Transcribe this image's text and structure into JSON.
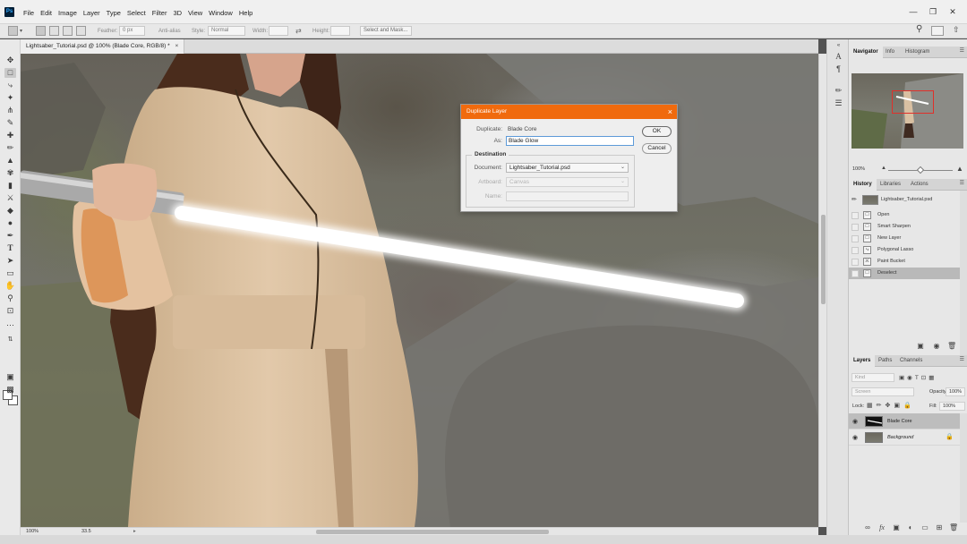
{
  "app": {
    "logo": "Ps",
    "menu": [
      "File",
      "Edit",
      "Image",
      "Layer",
      "Type",
      "Select",
      "Filter",
      "3D",
      "View",
      "Window",
      "Help"
    ],
    "window_controls": [
      "minimize",
      "restore",
      "close"
    ]
  },
  "options_bar": {
    "feather_label": "Feather:",
    "feather_value": "0 px",
    "antialias_label": "Anti-alias",
    "style_label": "Style:",
    "style_value": "Normal",
    "width_label": "Width:",
    "height_label": "Height:",
    "select_mask_label": "Select and Mask..."
  },
  "document": {
    "tab_title": "Lightsaber_Tutorial.psd @ 100% (Blade Core, RGB/8) *",
    "tab_close": "×",
    "zoom_status": "100%",
    "size_status": "33.5"
  },
  "dialog": {
    "title": "Duplicate Layer",
    "close": "×",
    "duplicate_label": "Duplicate:",
    "duplicate_value": "Blade Core",
    "as_label": "As:",
    "as_value": "Blade Glow",
    "destination_title": "Destination",
    "document_label": "Document:",
    "document_value": "Lightsaber_Tutorial.psd",
    "artboard_label": "Artboard:",
    "artboard_value": "Canvas",
    "name_label": "Name:",
    "ok_label": "OK",
    "cancel_label": "Cancel"
  },
  "navigator": {
    "tabs": [
      "Navigator",
      "Info",
      "Histogram"
    ],
    "zoom": "100%",
    "zoom_fraction": 0.5
  },
  "history": {
    "tabs": [
      "History",
      "Libraries",
      "Actions"
    ],
    "snapshot": "Lightsaber_Tutorial.psd",
    "items": [
      "Open",
      "Smart Sharpen",
      "New Layer",
      "Polygonal Lasso",
      "Paint Bucket",
      "Deselect"
    ],
    "active_item": "Deselect"
  },
  "layers": {
    "tabs": [
      "Layers",
      "Paths",
      "Channels"
    ],
    "kind_placeholder": "Kind",
    "blend_mode": "Screen",
    "opacity_label": "Opacity:",
    "opacity_value": "100%",
    "lock_label": "Lock:",
    "fill_label": "Fill:",
    "fill_value": "100%",
    "items": [
      {
        "name": "Blade Core",
        "active": true
      },
      {
        "name": "Background",
        "active": false
      }
    ]
  },
  "colors": {
    "dialog_title_bg": "#f06a0d",
    "nav_view_box": "#e0302a",
    "blade_glow": "#ffffff",
    "robe": "#d9bfa0"
  }
}
